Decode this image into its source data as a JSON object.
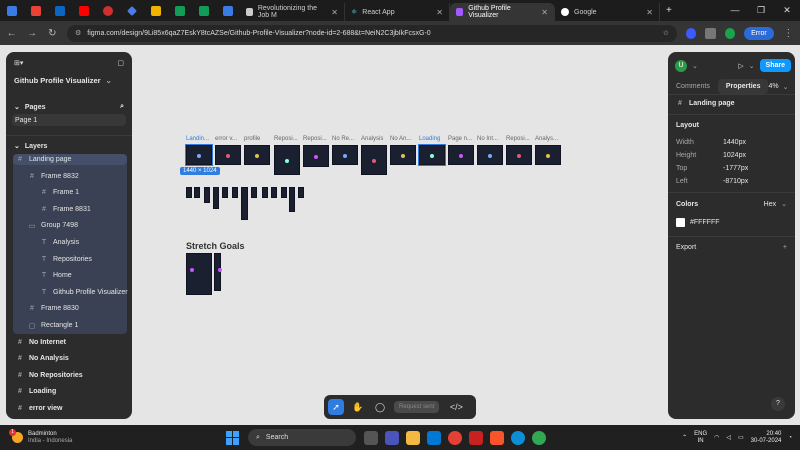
{
  "browser": {
    "tabs": [
      {
        "label": "Revolutionizing the Job M",
        "active": false
      },
      {
        "label": "React App",
        "active": false
      },
      {
        "label": "Github Profile Visualizer",
        "active": true
      },
      {
        "label": "Google",
        "active": false
      }
    ],
    "url": "figma.com/design/9Li85x6qaZ7EskY8tcAZSe/Github-Profile-Visualizer?node-id=2-688&t=NeiN2C3jbIkFcsxG-0",
    "error_label": "Error"
  },
  "left_panel": {
    "file_name": "Github Profile Visualizer",
    "pages_header": "Pages",
    "pages": [
      "Page 1"
    ],
    "layers_header": "Layers",
    "layers": [
      {
        "label": "Landing page",
        "indent": 0,
        "type": "frame",
        "selected": true
      },
      {
        "label": "Frame 8832",
        "indent": 1,
        "type": "frame"
      },
      {
        "label": "Frame 1",
        "indent": 2,
        "type": "frame"
      },
      {
        "label": "Frame 8831",
        "indent": 2,
        "type": "frame"
      },
      {
        "label": "Group 7498",
        "indent": 1,
        "type": "group"
      },
      {
        "label": "Analysis",
        "indent": 2,
        "type": "text"
      },
      {
        "label": "Repositories",
        "indent": 2,
        "type": "text"
      },
      {
        "label": "Home",
        "indent": 2,
        "type": "text"
      },
      {
        "label": "Github Profile Visualizer",
        "indent": 2,
        "type": "text"
      },
      {
        "label": "Frame 8830",
        "indent": 1,
        "type": "frame"
      },
      {
        "label": "Rectangle 1",
        "indent": 1,
        "type": "rect"
      },
      {
        "label": "No Internet",
        "indent": 0,
        "type": "frame",
        "bold": true
      },
      {
        "label": "No Analysis",
        "indent": 0,
        "type": "frame",
        "bold": true
      },
      {
        "label": "No Repositories",
        "indent": 0,
        "type": "frame",
        "bold": true
      },
      {
        "label": "Loading",
        "indent": 0,
        "type": "frame",
        "bold": true
      },
      {
        "label": "error view",
        "indent": 0,
        "type": "frame",
        "bold": true
      }
    ]
  },
  "canvas": {
    "frame_labels": [
      "Landin...",
      "error v...",
      "profile",
      "Reposi...",
      "Reposi...",
      "No Re...",
      "Analysis",
      "No An...",
      "Loading",
      "Page n...",
      "No Int...",
      "Reposi...",
      "Analys..."
    ],
    "size_badge": "1440 × 1024",
    "section_title": "Stretch Goals"
  },
  "toolbar": {
    "request_label": "Request sent",
    "code_label": "</>"
  },
  "right_panel": {
    "tabs": [
      "Comments",
      "Properties"
    ],
    "zoom": "4%",
    "share_label": "Share",
    "avatar_letter": "U",
    "selection_name": "Landing page",
    "layout_header": "Layout",
    "layout": [
      {
        "key": "Width",
        "value": "1440px"
      },
      {
        "key": "Height",
        "value": "1024px"
      },
      {
        "key": "Top",
        "value": "-1777px"
      },
      {
        "key": "Left",
        "value": "-8710px"
      }
    ],
    "colors_header": "Colors",
    "color_format": "Hex",
    "color_value": "#FFFFFF",
    "export_header": "Export",
    "help": "?"
  },
  "taskbar": {
    "weather_title": "Badminton",
    "weather_sub": "India - Indonesia",
    "weather_badge": "1",
    "search_label": "Search",
    "lang": "ENG",
    "region": "IN",
    "time": "20:40",
    "date": "30-07-2024"
  },
  "colors": {
    "accent": "#2f7de1",
    "canvas": "#e5e5e5",
    "panel": "#2c2c2c"
  }
}
